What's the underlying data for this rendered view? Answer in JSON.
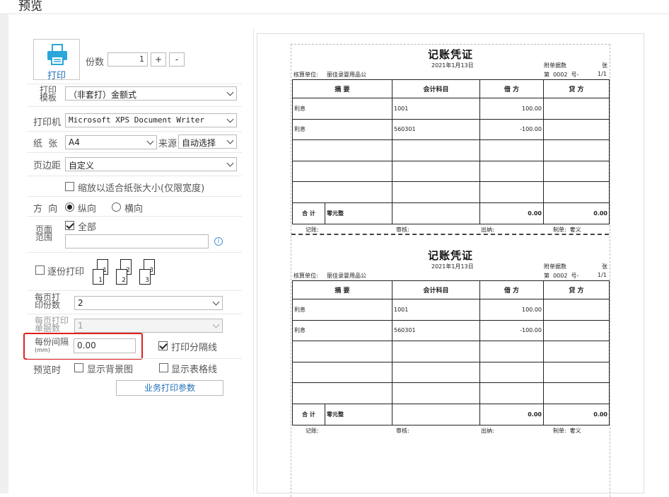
{
  "window": {
    "title": "预览"
  },
  "settings": {
    "print_button_label": "打印",
    "copies_label": "份数",
    "copies_value": "1",
    "copies_inc": "+",
    "copies_dec": "-",
    "template_label_1": "打印",
    "template_label_2": "模板",
    "template_value": "（非套打）金额式",
    "printer_label": "打印机",
    "printer_value": "Microsoft XPS Document Writer",
    "paper_label": "纸  张",
    "paper_value": "A4",
    "source_label": "来源",
    "source_value": "自动选择",
    "margin_label": "页边距",
    "margin_value": "自定义",
    "fit_width_label": "缩放以适合纸张大小(仅限宽度)",
    "orientation_label": "方  向",
    "portrait_label": "纵向",
    "landscape_label": "横向",
    "page_range_label_1": "页面",
    "page_range_label_2": "范围",
    "all_pages_label": "全部",
    "page_range_value": "",
    "collate_label": "逐份打印",
    "collate_numbers": [
      "1",
      "1",
      "2",
      "2",
      "3",
      "3"
    ],
    "copies_per_page_label_1": "每页打",
    "copies_per_page_label_2": "印份数",
    "copies_per_page_value": "2",
    "entries_per_page_label_1": "每页打印",
    "entries_per_page_label_2": "单据数",
    "entries_per_page_value": "1",
    "gap_label_1": "每份间隔",
    "gap_label_2": "(mm)",
    "gap_value": "0.00",
    "print_separator_label": "打印分隔线",
    "preview_label": "预览时",
    "show_background_label": "显示背景图",
    "show_grid_label": "显示表格线",
    "business_params_label": "业务打印参数"
  },
  "voucher": {
    "title": "记账凭证",
    "date": "2021年1月13日",
    "attach_label": "附单据数",
    "attach_unit": "张",
    "unit_label": "核算单位:",
    "unit_name": "丽佳录婴用品公",
    "number_text": "第  0002  号-",
    "page_text": "1/1",
    "headers": [
      "摘  要",
      "会计科目",
      "借  方",
      "贷  方"
    ],
    "rows": [
      [
        "利息",
        "1001",
        "100.00",
        ""
      ],
      [
        "利息",
        "560301",
        "-100.00",
        ""
      ],
      [
        "",
        "",
        "",
        ""
      ],
      [
        "",
        "",
        "",
        ""
      ],
      [
        "",
        "",
        "",
        ""
      ]
    ],
    "total_label": "合  计",
    "total_words": "零元整",
    "total_debit": "0.00",
    "total_credit": "0.00",
    "footer": {
      "bookkeeper": "记账:",
      "reviewer": "审核:",
      "cashier": "出纳:",
      "maker": "制单:  奢义"
    }
  },
  "colors": {
    "highlight": "#e02020",
    "accent": "#1f6fb8"
  }
}
